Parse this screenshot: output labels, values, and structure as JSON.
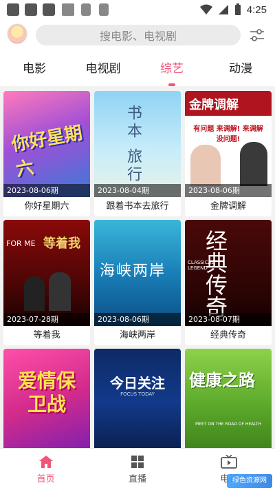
{
  "status_bar": {
    "time": "4:25"
  },
  "header": {
    "search_placeholder": "搜电影、电视剧"
  },
  "tabs": [
    {
      "label": "电影",
      "active": false
    },
    {
      "label": "电视剧",
      "active": false
    },
    {
      "label": "综艺",
      "active": true
    },
    {
      "label": "动漫",
      "active": false
    }
  ],
  "cards": [
    {
      "title": "你好星期六",
      "episode": "2023-08-06期",
      "poster_text": "你好星期六"
    },
    {
      "title": "跟着书本去旅行",
      "episode": "2023-08-04期",
      "poster_text": "书本 旅行"
    },
    {
      "title": "金牌调解",
      "episode": "2023-08-06期",
      "poster_text": "金牌调解",
      "poster_sub": "有问题 来调解! 来调解 没问题!"
    },
    {
      "title": "等着我",
      "episode": "2023-07-28期",
      "poster_text": "等着我",
      "poster_sub": "FOR ME"
    },
    {
      "title": "海峡两岸",
      "episode": "2023-08-06期",
      "poster_text": "海峡两岸"
    },
    {
      "title": "经典传奇",
      "episode": "2023-08-07期",
      "poster_text": "经典传奇",
      "poster_sub": "CLASSICAL LEGEND"
    },
    {
      "title": "",
      "episode": "",
      "poster_text": "爱情保卫战"
    },
    {
      "title": "",
      "episode": "",
      "poster_text": "今日关注",
      "poster_sub": "FOCUS TODAY"
    },
    {
      "title": "",
      "episode": "",
      "poster_text": "健康之路",
      "poster_sub": "MEET ON THE ROAD OF HEALTH"
    }
  ],
  "bottom_nav": [
    {
      "label": "首页",
      "icon": "home-icon",
      "active": true
    },
    {
      "label": "直播",
      "icon": "grid-icon",
      "active": false
    },
    {
      "label": "电视",
      "icon": "tv-icon",
      "active": false
    }
  ],
  "watermark": "绿色资源网",
  "colors": {
    "accent": "#f0567a",
    "header_bg": "#ffffff",
    "page_bg": "#f2f2f2"
  }
}
